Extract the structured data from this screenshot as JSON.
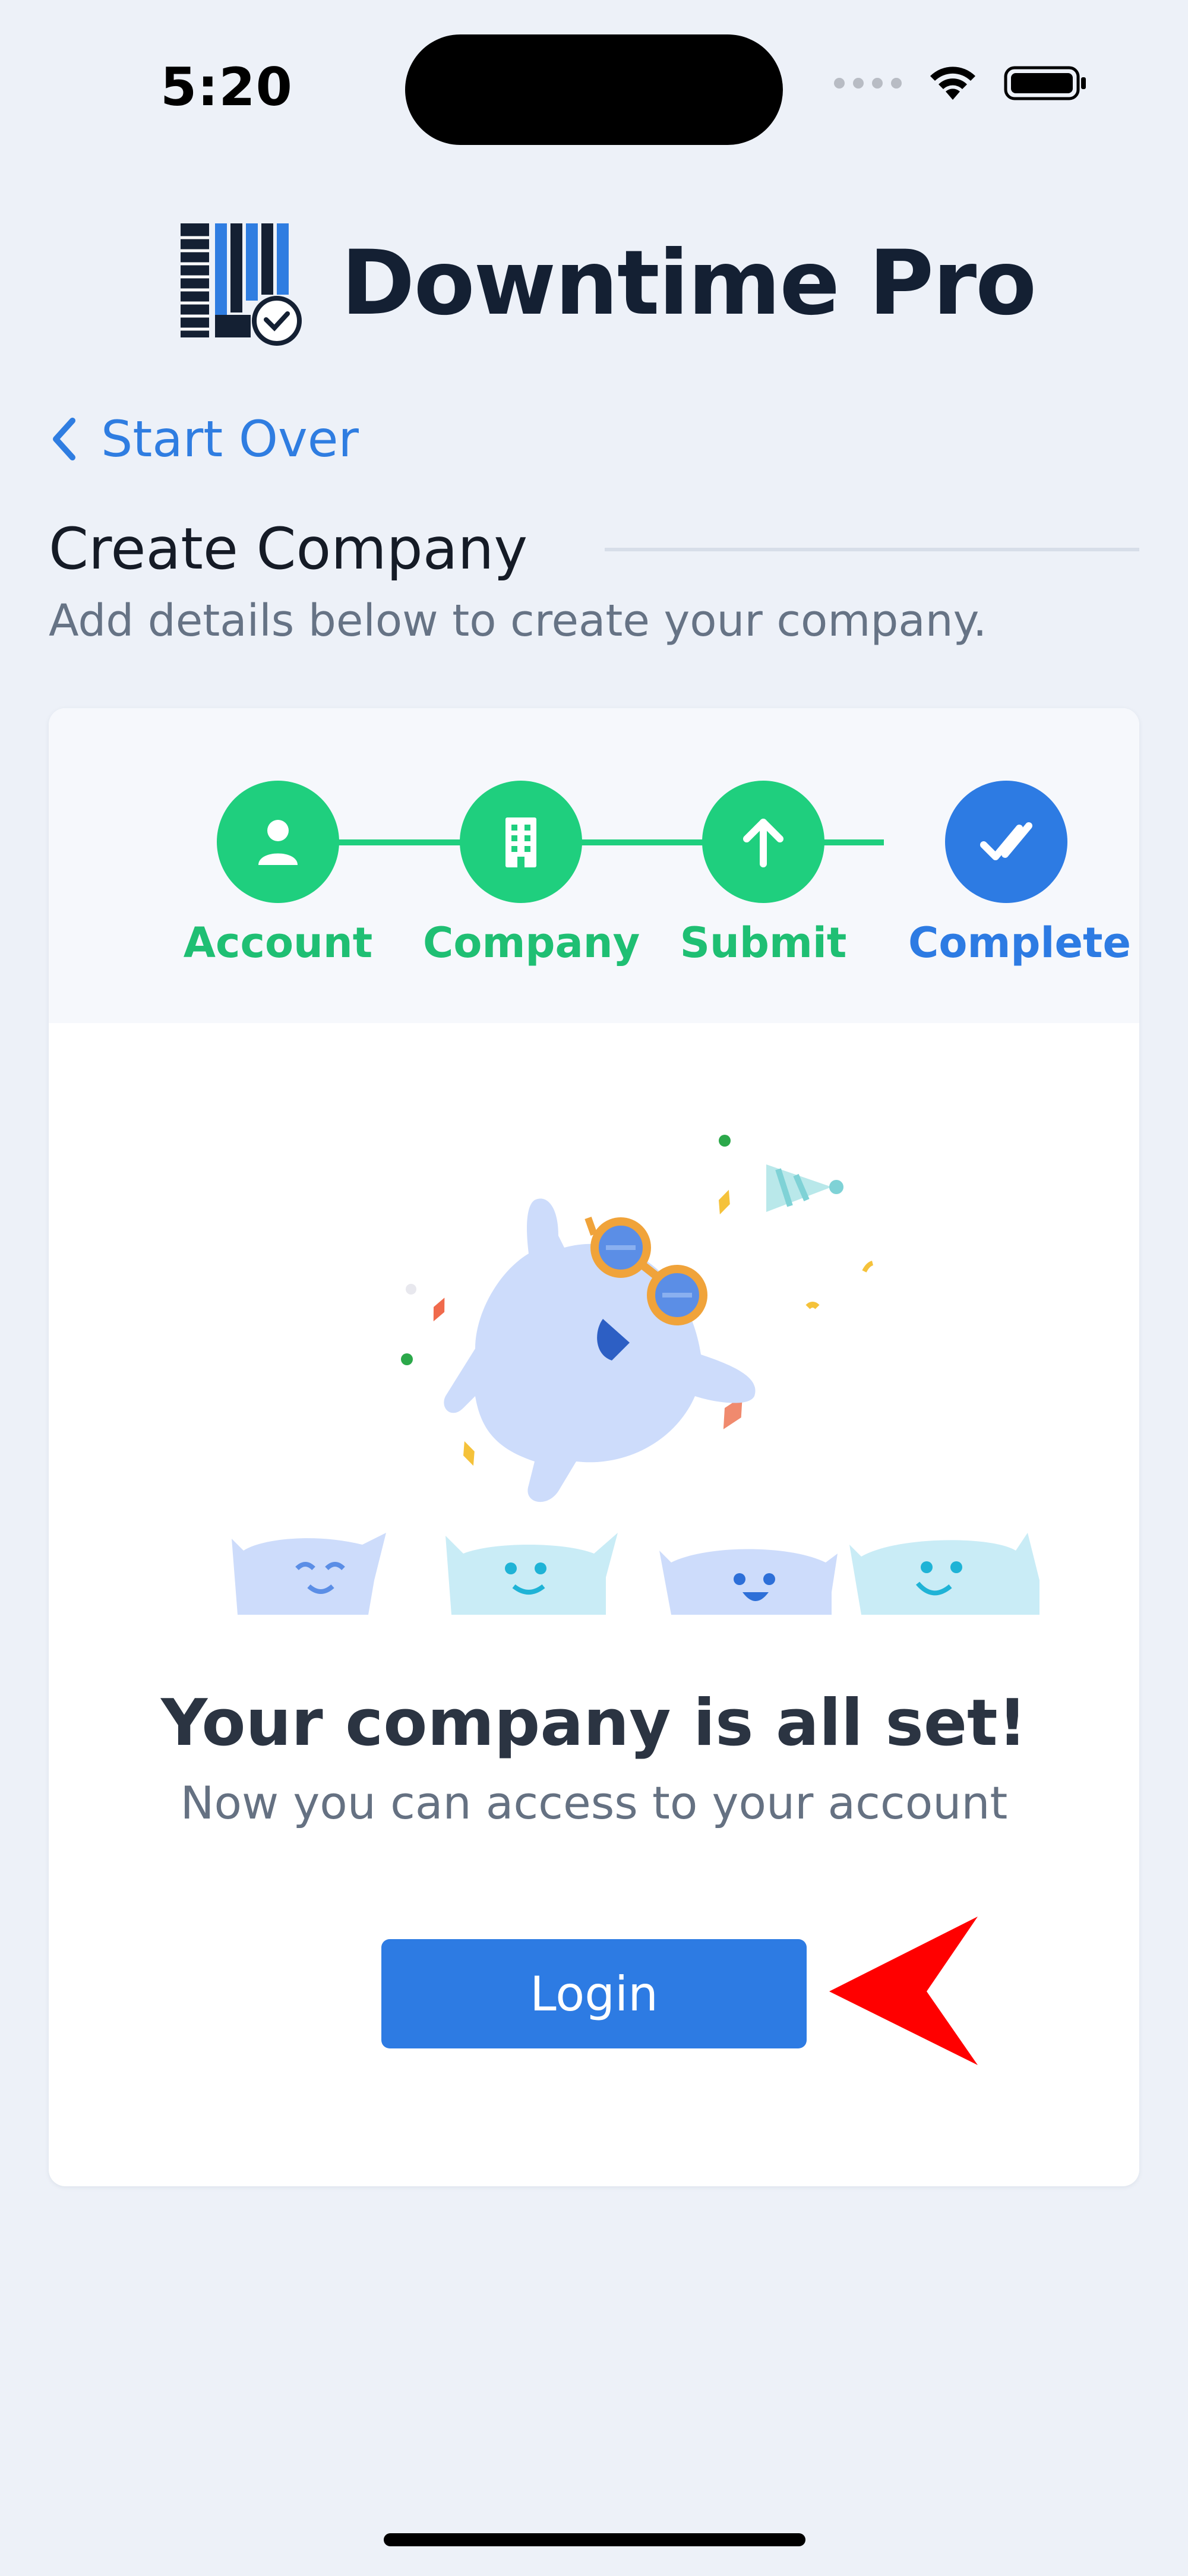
{
  "status_bar": {
    "time": "5:20"
  },
  "brand": {
    "name": "Downtime Pro"
  },
  "nav": {
    "back_label": "Start Over"
  },
  "header": {
    "title": "Create Company",
    "subtitle": "Add details below to create your company."
  },
  "stepper": {
    "steps": [
      {
        "label": "Account",
        "icon": "user-icon",
        "state": "done"
      },
      {
        "label": "Company",
        "icon": "building-icon",
        "state": "done"
      },
      {
        "label": "Submit",
        "icon": "arrow-up-icon",
        "state": "done"
      },
      {
        "label": "Complete",
        "icon": "double-check-icon",
        "state": "active"
      }
    ]
  },
  "result": {
    "title": "Your company is all set!",
    "message": "Now you can access to your account",
    "login_label": "Login"
  },
  "colors": {
    "accent": "#2d7be3",
    "success": "#1fcf7e",
    "background": "#edf1f8",
    "annotation_arrow": "#ff0000"
  }
}
